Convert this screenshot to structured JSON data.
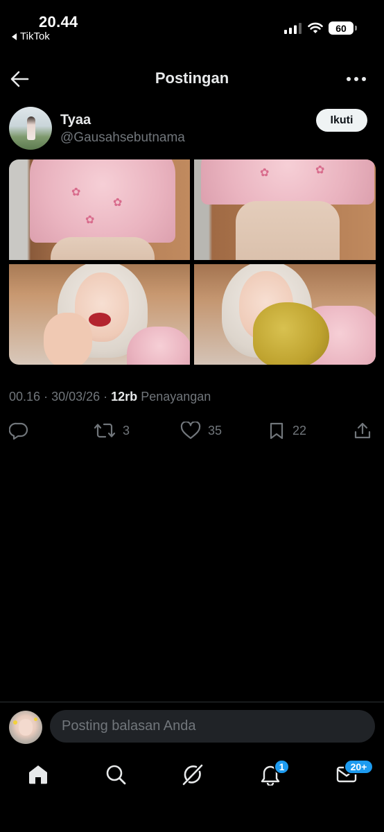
{
  "status_bar": {
    "time": "20.44",
    "back_app": "TikTok",
    "battery": "60"
  },
  "header": {
    "title": "Postingan"
  },
  "post": {
    "author_name": "Tyaa",
    "author_handle": "@Gausahsebutnama",
    "follow_label": "Ikuti",
    "time": "00.16",
    "date": "30/03/26",
    "views_count": "12rb",
    "views_label": "Penayangan",
    "retweets": "3",
    "likes": "35",
    "bookmarks": "22"
  },
  "reply": {
    "placeholder": "Posting balasan Anda"
  },
  "bottom_nav": {
    "notifications_badge": "1",
    "messages_badge": "20+"
  },
  "colors": {
    "background": "#000000",
    "text_primary": "#e7e9ea",
    "text_secondary": "#71767b",
    "accent": "#1d9bf0",
    "input_bg": "#202327"
  },
  "icons": [
    "back-arrow-icon",
    "more-icon",
    "reply-icon",
    "retweet-icon",
    "like-icon",
    "bookmark-icon",
    "share-icon",
    "home-icon",
    "search-icon",
    "grok-icon",
    "bell-icon",
    "mail-icon"
  ]
}
